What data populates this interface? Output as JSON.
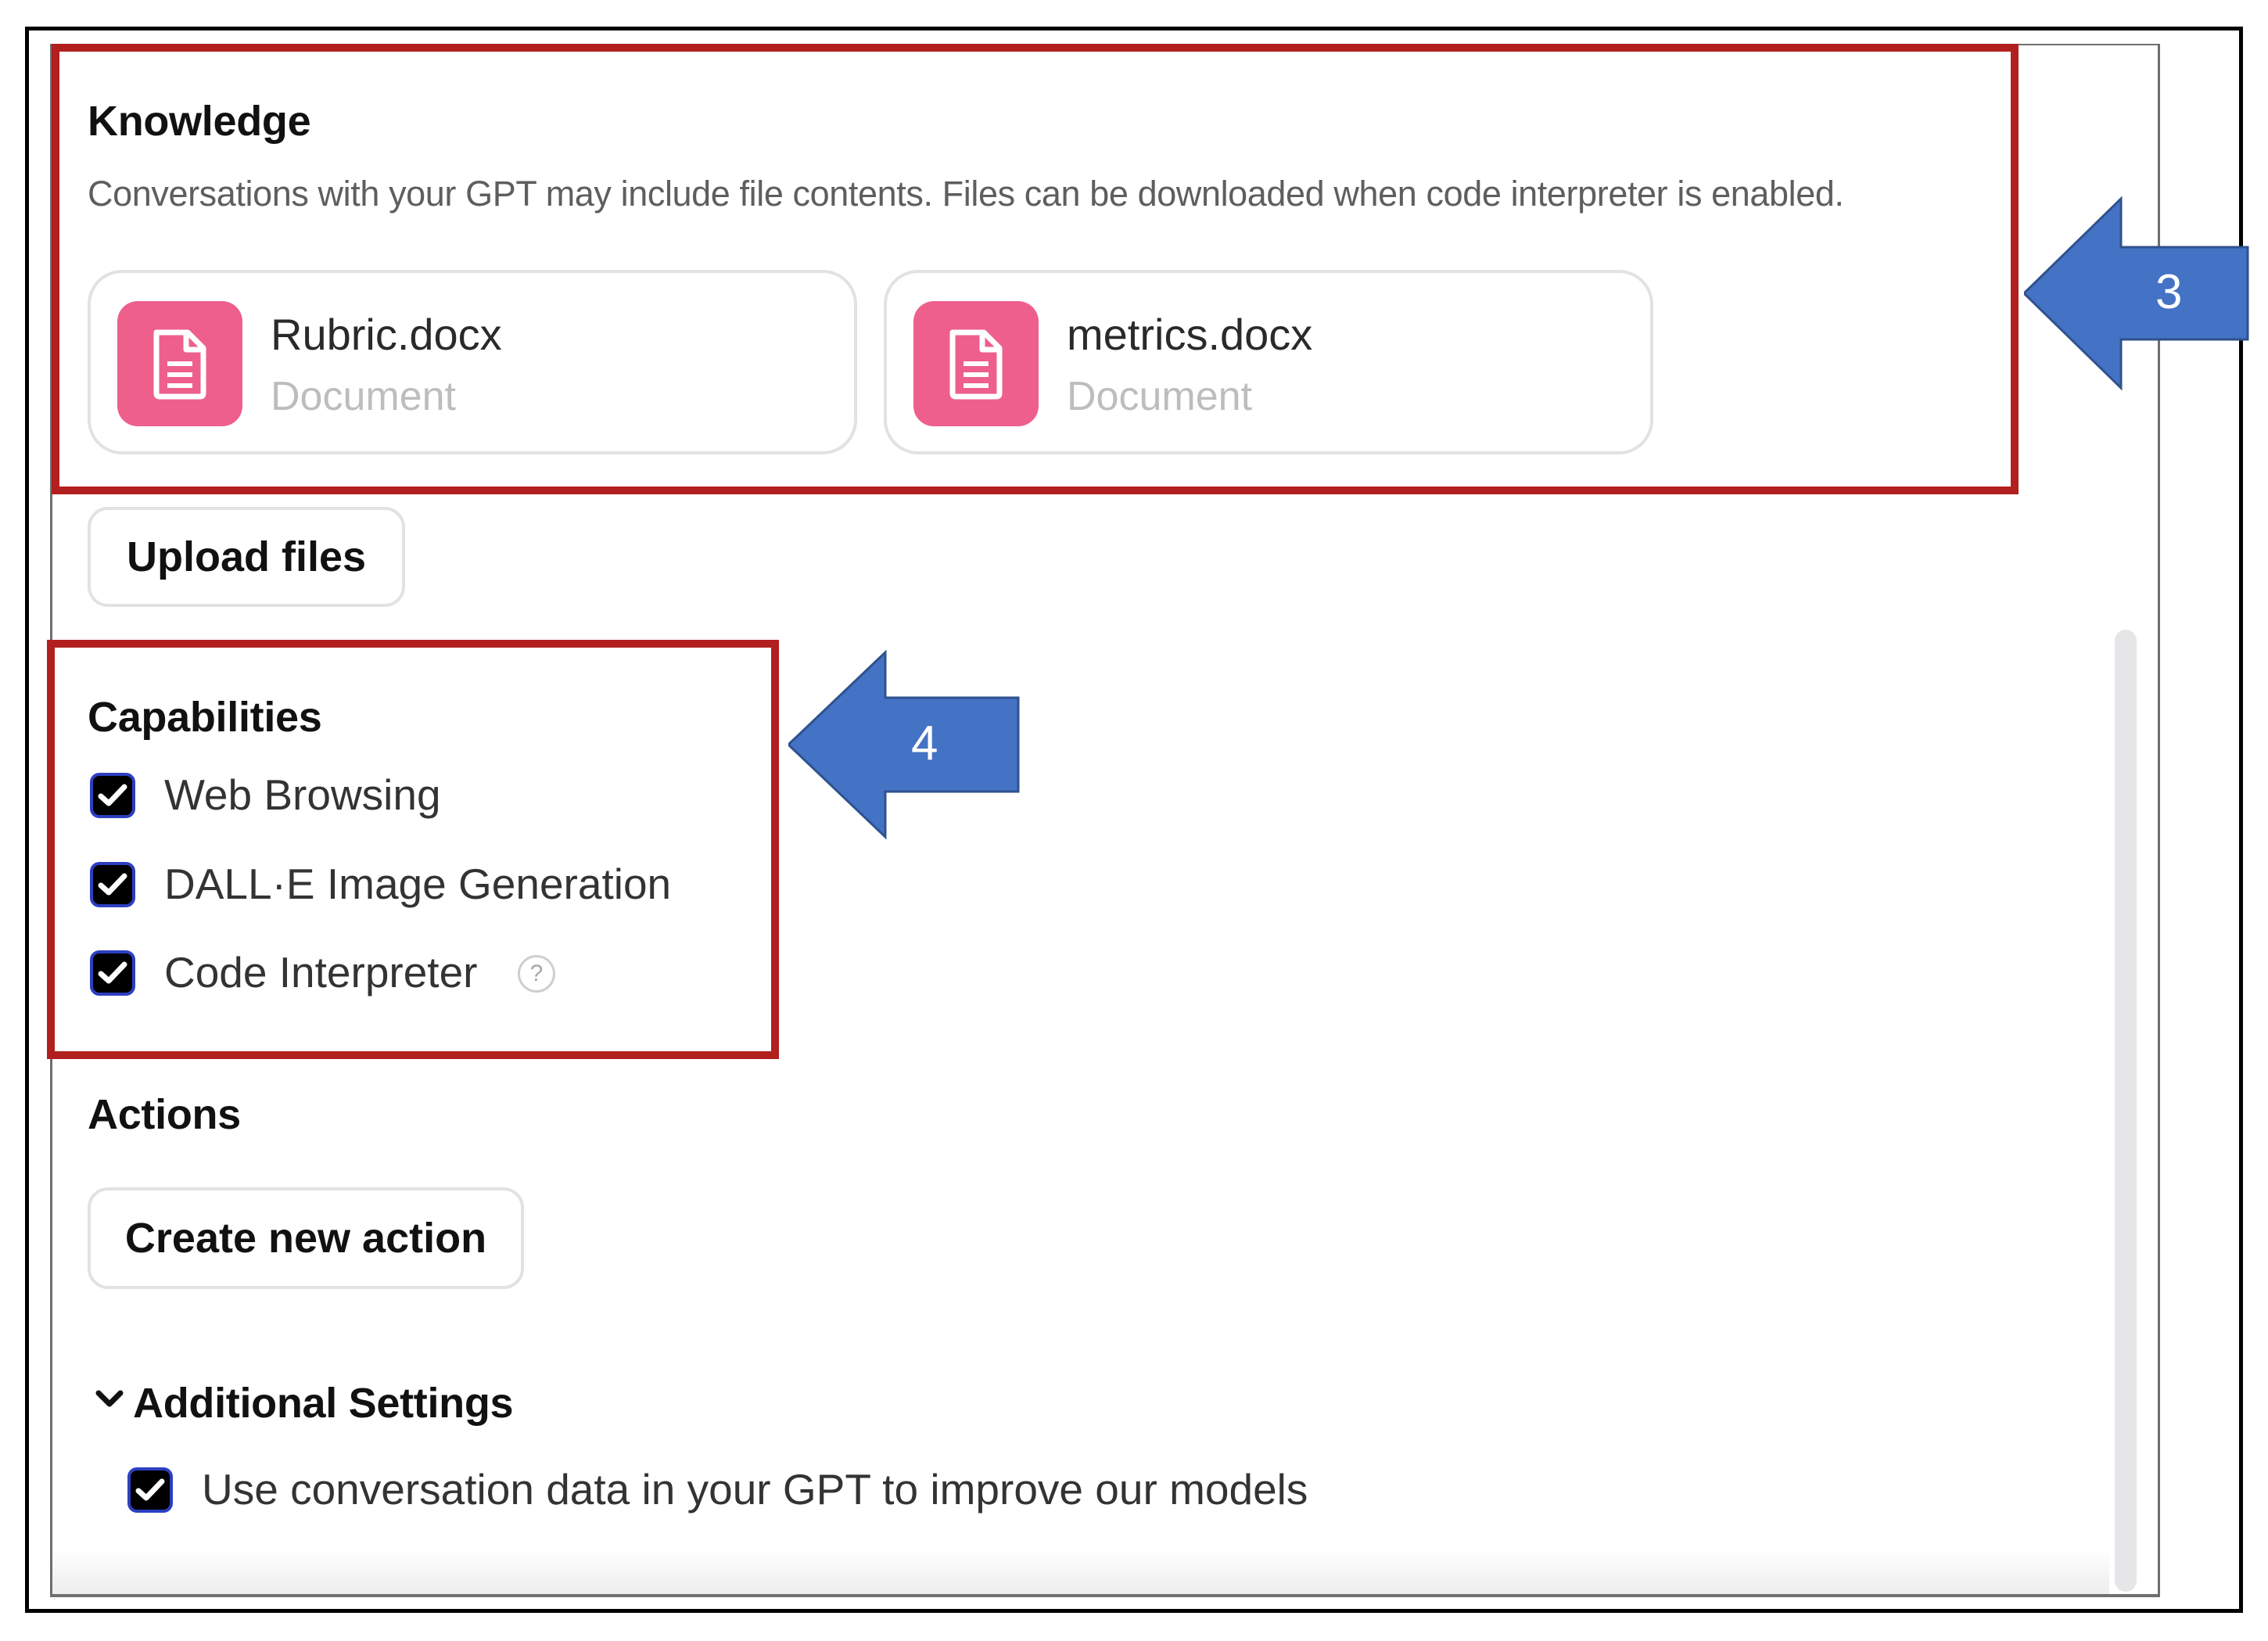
{
  "knowledge": {
    "title": "Knowledge",
    "description": "Conversations with your GPT may include file contents. Files can be downloaded when code interpreter is enabled.",
    "files": [
      {
        "name": "Rubric.docx",
        "type": "Document",
        "icon": "document-icon"
      },
      {
        "name": "metrics.docx",
        "type": "Document",
        "icon": "document-icon"
      }
    ],
    "upload_label": "Upload files"
  },
  "capabilities": {
    "title": "Capabilities",
    "items": [
      {
        "label": "Web Browsing",
        "checked": true
      },
      {
        "label": "DALL·E Image Generation",
        "checked": true
      },
      {
        "label": "Code Interpreter",
        "checked": true,
        "help": "?"
      }
    ]
  },
  "actions": {
    "title": "Actions",
    "create_label": "Create new action"
  },
  "additional_settings": {
    "title": "Additional Settings",
    "chevron_icon": "chevron-down-icon",
    "items": [
      {
        "label": "Use conversation data in your GPT to improve our models",
        "checked": true
      }
    ]
  },
  "annotations": {
    "callouts": [
      "3",
      "4"
    ],
    "highlight_color": "#b21f1f",
    "arrow_color": "#4472c4"
  },
  "colors": {
    "file_icon_bg": "#ee5f8c",
    "checkbox_fill": "#000000",
    "checkbox_border": "#2c3fc0"
  }
}
